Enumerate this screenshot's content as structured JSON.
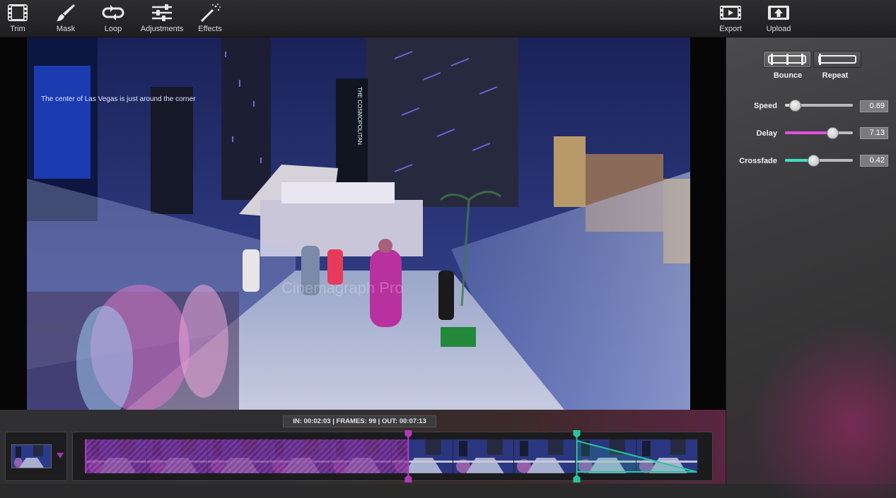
{
  "toolbar": {
    "left": [
      {
        "label": "Trim",
        "icon": "film-icon"
      },
      {
        "label": "Mask",
        "icon": "brush-icon"
      },
      {
        "label": "Loop",
        "icon": "loop-icon"
      },
      {
        "label": "Adjustments",
        "icon": "sliders-icon"
      },
      {
        "label": "Effects",
        "icon": "magic-wand-icon"
      }
    ],
    "right": [
      {
        "label": "Export",
        "icon": "export-film-icon"
      },
      {
        "label": "Upload",
        "icon": "upload-icon"
      }
    ]
  },
  "canvas": {
    "sign_left": "The center of Las Vegas is just around the corner",
    "sign_hotel": "THE COSMOPOLITAN",
    "watermark": "Cinemagraph Pro"
  },
  "panel": {
    "modes": [
      {
        "label": "Bounce",
        "active": true
      },
      {
        "label": "Repeat",
        "active": false
      }
    ],
    "sliders": [
      {
        "label": "Speed",
        "value": "0.69",
        "level": 0.15,
        "color": "#d8d8d8"
      },
      {
        "label": "Delay",
        "value": "7.13",
        "level": 0.7,
        "color": "#e050e0"
      },
      {
        "label": "Crossfade",
        "value": "0.42",
        "level": 0.42,
        "color": "#3ee0c0"
      }
    ]
  },
  "timeline": {
    "info": "IN: 00:02:03 | FRAMES: 99 | OUT: 00:07:13",
    "in_fraction": 0.527,
    "out_fraction": 0.802,
    "frame_count": 10,
    "colors": {
      "in_marker": "#b03ab8",
      "out_marker": "#28c4a0"
    }
  }
}
